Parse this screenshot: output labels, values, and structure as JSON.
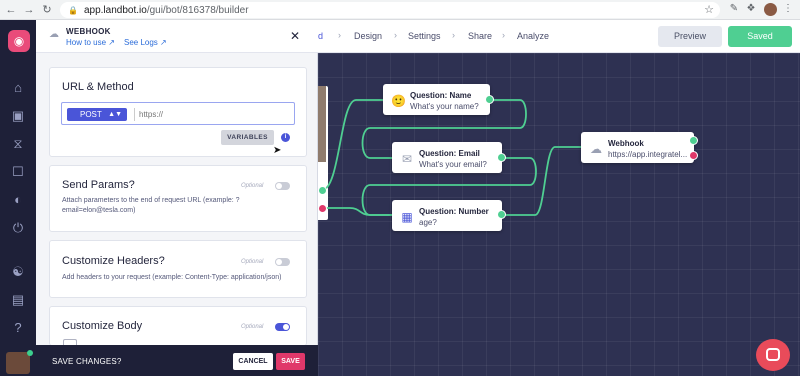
{
  "browser": {
    "url_host": "app.landbot.io",
    "url_path": "/gui/bot/816378/builder"
  },
  "topbar": {
    "steps": [
      "Build",
      "Design",
      "Settings",
      "Share",
      "Analyze"
    ],
    "visible_step_fragment": "ild",
    "preview_label": "Preview",
    "saved_label": "Saved"
  },
  "panel": {
    "title": "WEBHOOK",
    "how_to_use": "How to use",
    "see_logs": "See Logs",
    "url_method": {
      "title": "URL & Method",
      "method": "POST",
      "url_placeholder": "https://",
      "variables_label": "VARIABLES"
    },
    "send_params": {
      "title": "Send Params?",
      "optional": "Optional",
      "enabled": false,
      "desc": "Attach parameters to the end of request URL (example: ?email=elon@tesla.com)"
    },
    "headers": {
      "title": "Customize Headers?",
      "optional": "Optional",
      "enabled": false,
      "desc": "Add headers to your request (example: Content-Type: application/json)"
    },
    "body": {
      "title": "Customize Body",
      "optional": "Optional",
      "enabled": true
    }
  },
  "footer": {
    "label": "SAVE CHANGES?",
    "cancel": "CANCEL",
    "save": "SAVE"
  },
  "canvas": {
    "nodes": [
      {
        "title": "Question: Name",
        "sub": "What's your name?",
        "icon": "face-emoji-icon"
      },
      {
        "title": "Question: Email",
        "sub": "What's your email?",
        "icon": "envelope-icon"
      },
      {
        "title": "Question: Number",
        "sub": "age?",
        "icon": "number-keypad-icon"
      },
      {
        "title": "Webhook",
        "sub": "https://app.integratel...",
        "icon": "cloud-icon"
      }
    ]
  },
  "colors": {
    "accent": "#4a55d8",
    "success": "#4fcf92",
    "danger": "#e0386a",
    "canvas": "#2e3152",
    "rail": "#1e2038"
  }
}
